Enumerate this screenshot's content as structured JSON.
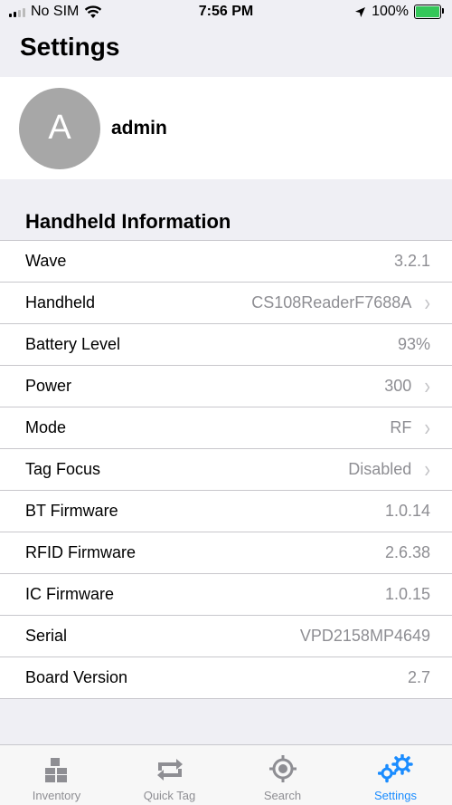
{
  "status_bar": {
    "carrier": "No SIM",
    "time": "7:56 PM",
    "battery": "100%",
    "battery_level": 1.0
  },
  "page": {
    "title": "Settings"
  },
  "profile": {
    "avatar_letter": "A",
    "username": "admin"
  },
  "section": {
    "title": "Handheld Information"
  },
  "rows": [
    {
      "label": "Wave",
      "value": "3.2.1",
      "chevron": false
    },
    {
      "label": "Handheld",
      "value": "CS108ReaderF7688A",
      "chevron": true
    },
    {
      "label": "Battery Level",
      "value": "93%",
      "chevron": false
    },
    {
      "label": "Power",
      "value": "300",
      "chevron": true
    },
    {
      "label": "Mode",
      "value": "RF",
      "chevron": true
    },
    {
      "label": "Tag Focus",
      "value": "Disabled",
      "chevron": true
    },
    {
      "label": "BT Firmware",
      "value": "1.0.14",
      "chevron": false
    },
    {
      "label": "RFID Firmware",
      "value": "2.6.38",
      "chevron": false
    },
    {
      "label": "IC Firmware",
      "value": "1.0.15",
      "chevron": false
    },
    {
      "label": "Serial",
      "value": "VPD2158MP4649",
      "chevron": false
    },
    {
      "label": "Board Version",
      "value": "2.7",
      "chevron": false
    }
  ],
  "tabs": [
    {
      "label": "Inventory",
      "icon": "boxes-icon"
    },
    {
      "label": "Quick Tag",
      "icon": "repeat-icon"
    },
    {
      "label": "Search",
      "icon": "crosshair-icon"
    },
    {
      "label": "Settings",
      "icon": "gears-icon",
      "active": true
    }
  ],
  "colors": {
    "accent": "#1a8cff",
    "battery": "#34c759",
    "avatar": "#a7a7a7"
  }
}
